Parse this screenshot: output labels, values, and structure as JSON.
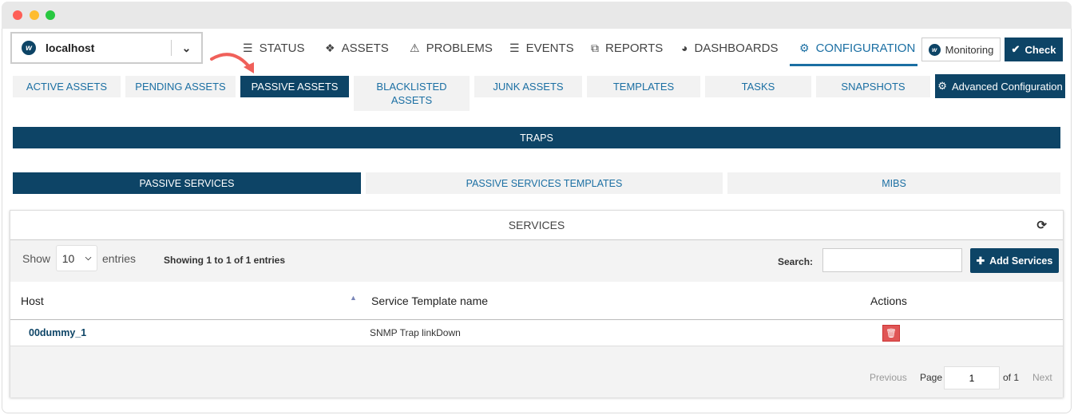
{
  "host_selector": {
    "value": "localhost"
  },
  "nav": [
    {
      "label": "STATUS",
      "icon": "list-icon"
    },
    {
      "label": "ASSETS",
      "icon": "cubes-icon"
    },
    {
      "label": "PROBLEMS",
      "icon": "warning-icon"
    },
    {
      "label": "EVENTS",
      "icon": "database-icon"
    },
    {
      "label": "REPORTS",
      "icon": "copy-icon"
    },
    {
      "label": "DASHBOARDS",
      "icon": "gauge-icon"
    },
    {
      "label": "CONFIGURATION",
      "icon": "gear-icon",
      "active": true
    }
  ],
  "monitoring_label": "Monitoring",
  "check_label": "Check",
  "tabs": [
    "ACTIVE ASSETS",
    "PENDING ASSETS",
    "PASSIVE ASSETS",
    "BLACKLISTED ASSETS",
    "JUNK ASSETS",
    "TEMPLATES",
    "TASKS",
    "SNAPSHOTS"
  ],
  "active_tab": "PASSIVE ASSETS",
  "advanced_label": "Advanced Configuration",
  "traps_label": "TRAPS",
  "subtabs": [
    "PASSIVE SERVICES",
    "PASSIVE SERVICES TEMPLATES",
    "MIBS"
  ],
  "panel": {
    "title": "SERVICES",
    "show_label": "Show",
    "page_size": "10",
    "entries_label": "entries",
    "info": "Showing 1 to 1 of 1 entries",
    "search_label": "Search:",
    "search_value": "",
    "add_label": "Add Services",
    "columns": [
      "Host",
      "Service Template name",
      "Actions"
    ],
    "rows": [
      {
        "host": "00dummy_1",
        "template": "SNMP Trap linkDown"
      }
    ],
    "pager": {
      "previous": "Previous",
      "page_label": "Page",
      "page": "1",
      "of": "of 1",
      "next": "Next"
    }
  },
  "colors": {
    "primary": "#0d4466",
    "link": "#1b6fa3",
    "danger": "#e05555",
    "arrow": "#f0605a"
  }
}
